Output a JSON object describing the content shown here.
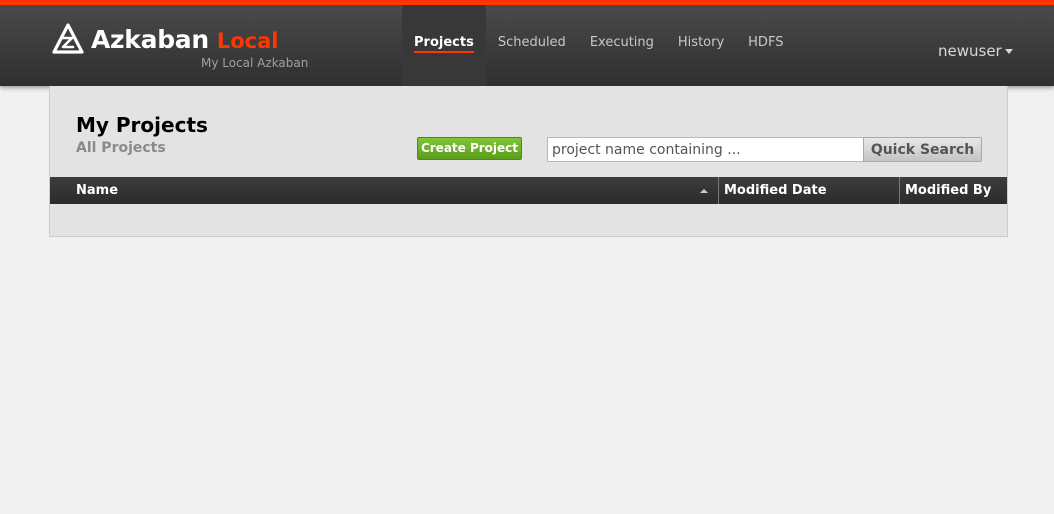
{
  "brand": {
    "name": "Azkaban",
    "env": "Local",
    "subtitle": "My Local Azkaban"
  },
  "nav": {
    "items": [
      {
        "label": "Projects",
        "active": true
      },
      {
        "label": "Scheduled",
        "active": false
      },
      {
        "label": "Executing",
        "active": false
      },
      {
        "label": "History",
        "active": false
      },
      {
        "label": "HDFS",
        "active": false
      }
    ]
  },
  "user": {
    "name": "newuser"
  },
  "page": {
    "title": "My Projects",
    "subtitle": "All Projects"
  },
  "toolbar": {
    "create_label": "Create Project",
    "search_placeholder": "project name containing ...",
    "search_value": "",
    "search_button_label": "Quick Search"
  },
  "table": {
    "columns": [
      "Name",
      "Modified Date",
      "Modified By"
    ],
    "sort": {
      "column": "Name",
      "direction": "ascending"
    },
    "rows": []
  },
  "colors": {
    "accent": "#ff3601",
    "create_button": "#6aaf26",
    "header_bg": "#333333"
  }
}
